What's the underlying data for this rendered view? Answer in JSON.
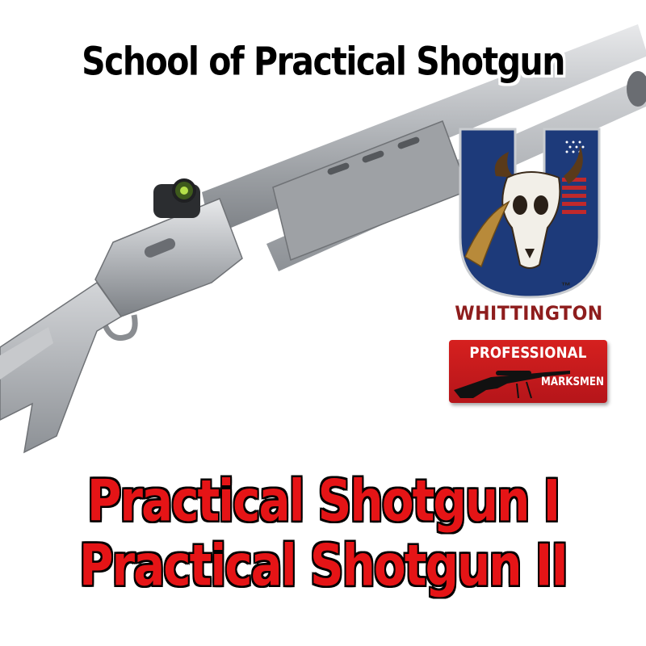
{
  "page": {
    "title": "School of Practical Shotgun",
    "courses": [
      "Practical Shotgun I",
      "Practical Shotgun II"
    ]
  },
  "logos": {
    "whittington": {
      "wordmark": "WHITTINGTON",
      "trademark": "™",
      "emblem": "skull-feather-U-icon"
    },
    "professional_marksmen": {
      "line1": "PROFESSIONAL",
      "line2": "MARKSMEN",
      "emblem": "rifle-icon"
    }
  },
  "colors": {
    "course_text": "#e51416",
    "title_text": "#000000",
    "logo_blue": "#1d3a7a",
    "logo_red": "#8e1d1d",
    "badge_red": "#c41a1c",
    "shotgun_steel": "#b9bcc0"
  }
}
